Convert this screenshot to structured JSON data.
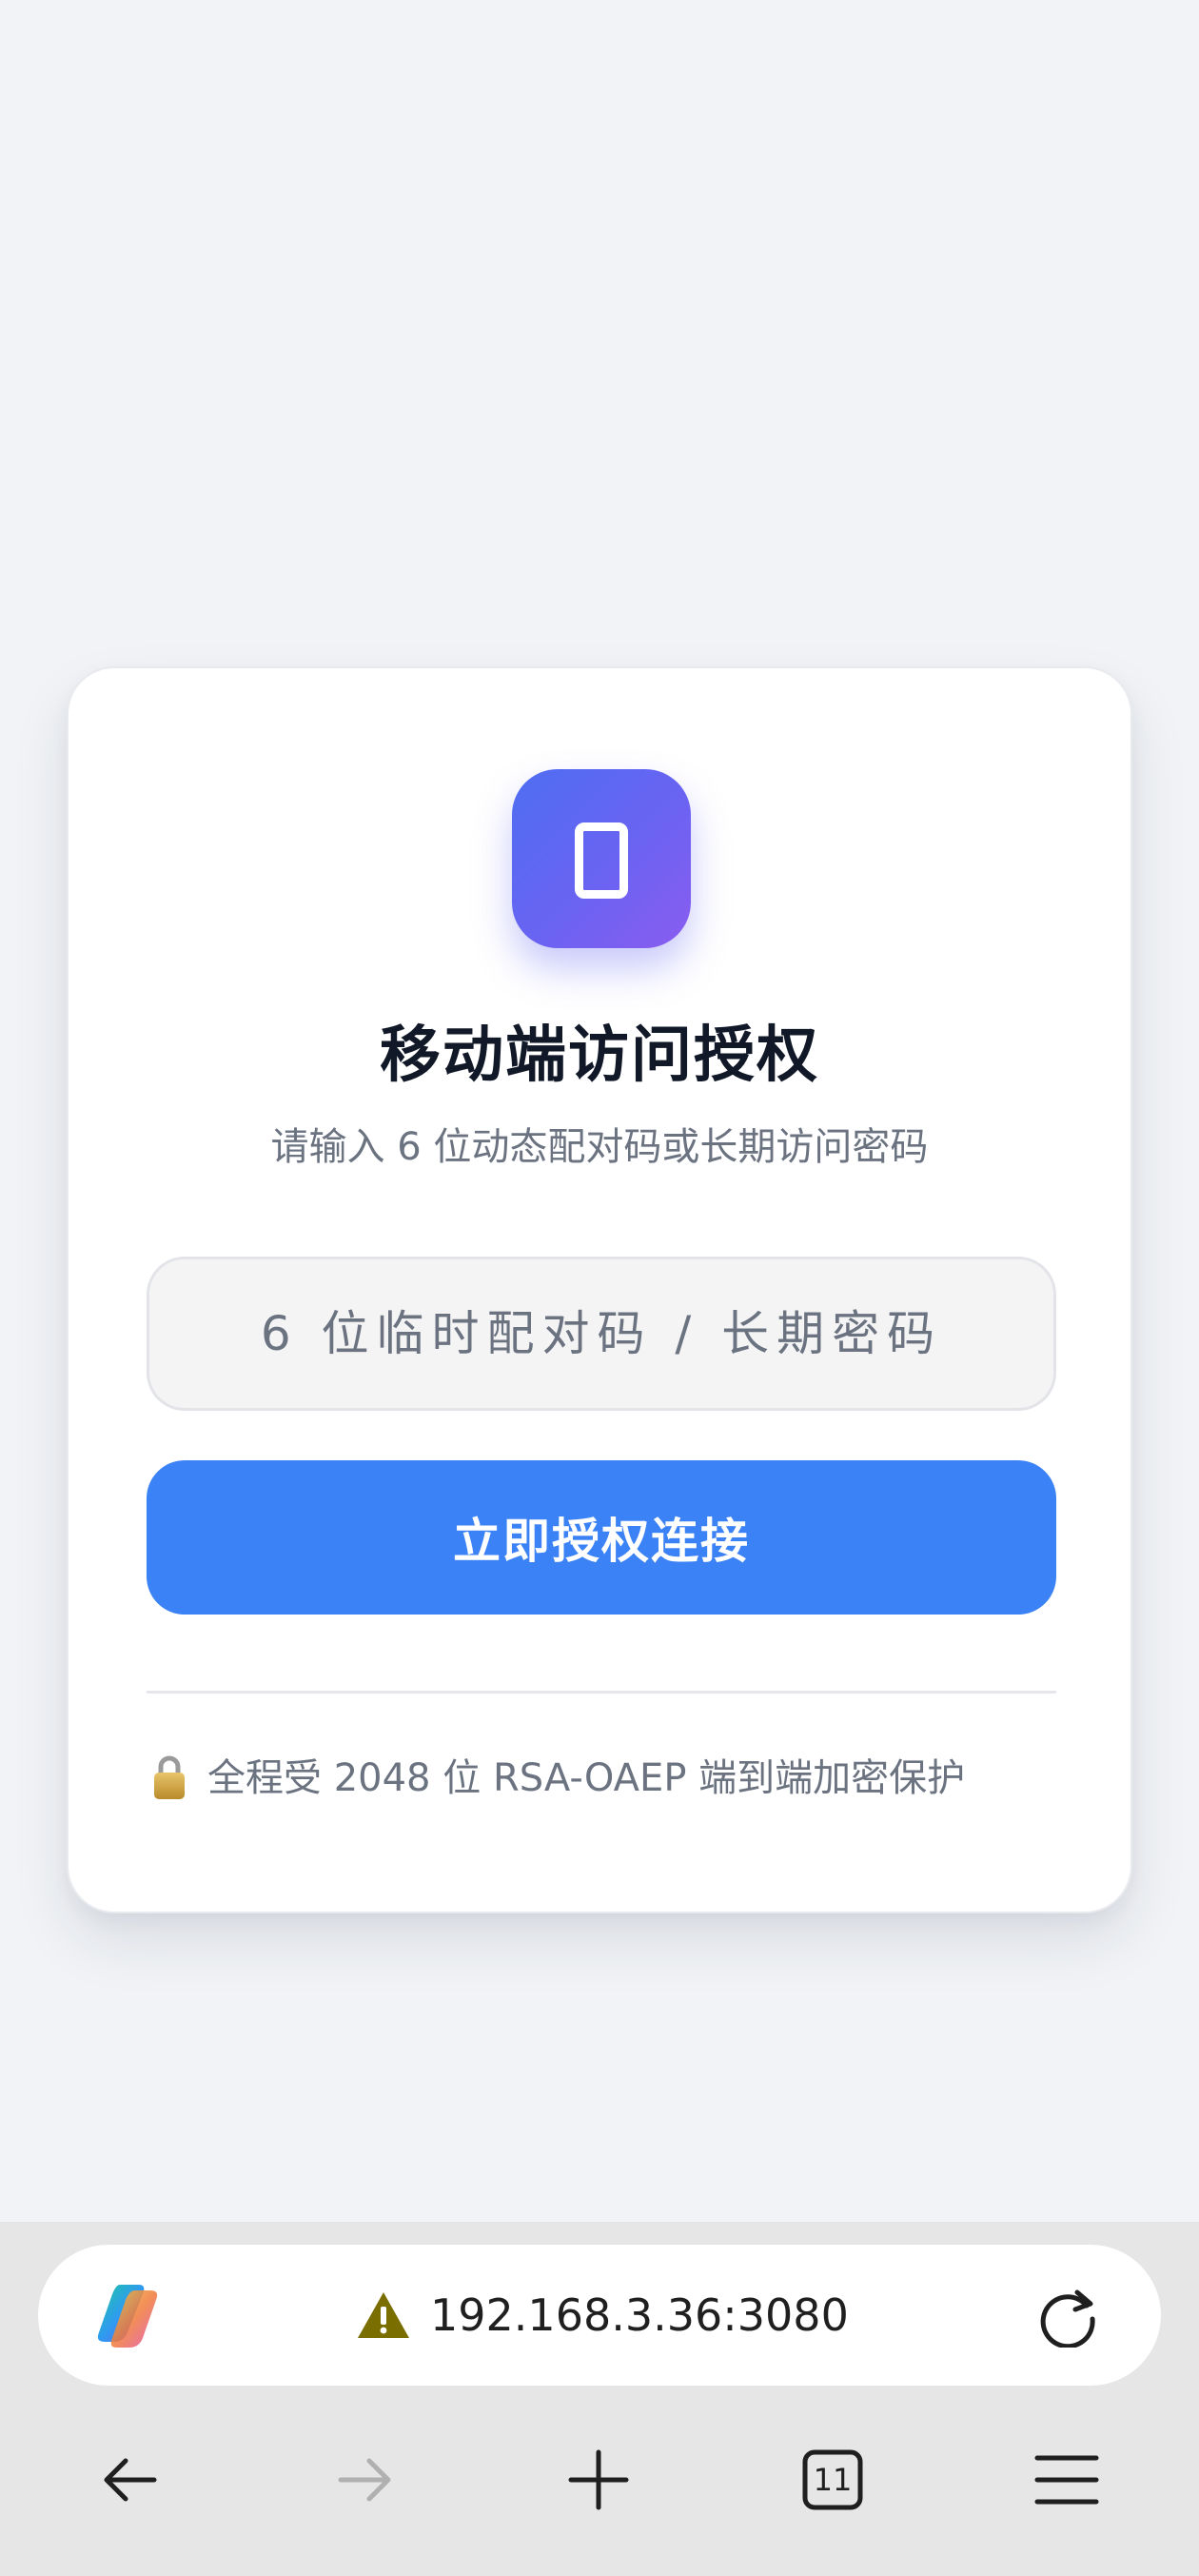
{
  "auth_card": {
    "title": "移动端访问授权",
    "subtitle": "请输入 6 位动态配对码或长期访问密码",
    "code_input": {
      "placeholder": "6 位临时配对码 / 长期密码",
      "value": ""
    },
    "submit_label": "立即授权连接",
    "security_note": "全程受 2048 位 RSA-OAEP 端到端加密保护",
    "icon": "smartphone-icon",
    "accent_color": "#3b82f6",
    "icon_gradient": [
      "#4e6ef2",
      "#8a5cf0"
    ]
  },
  "browser": {
    "url": "192.168.3.36:3080",
    "security_status_icon": "warning-icon",
    "assistant_icon": "copilot-icon",
    "tab_count": "11",
    "nav_icons": [
      "back-arrow-icon",
      "forward-arrow-icon",
      "new-tab-plus-icon",
      "tab-switcher-icon",
      "menu-icon"
    ],
    "warning_color": "#7a6e00"
  }
}
